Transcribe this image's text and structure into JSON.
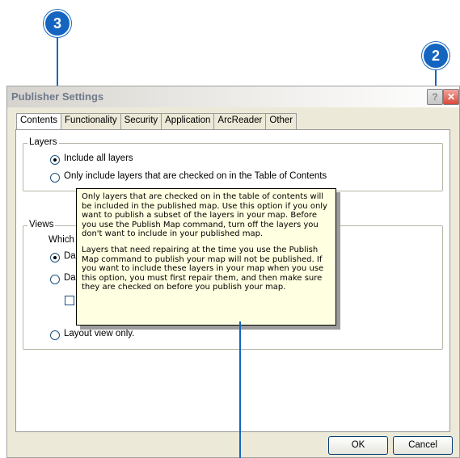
{
  "callouts": {
    "c3": "3",
    "c2": "2"
  },
  "dialog": {
    "title": "Publisher Settings",
    "help_icon": "question-icon",
    "close_icon": "close-icon",
    "tabs": [
      "Contents",
      "Functionality",
      "Security",
      "Application",
      "ArcReader",
      "Other"
    ],
    "layers": {
      "label": "Layers",
      "option_all": "Include all layers",
      "option_checked": "Only include layers that are checked on in the Table of Contents"
    },
    "views": {
      "label": "Views",
      "prompt_partial": "Which",
      "option1_partial": "Da",
      "option2_partial": "Da",
      "option3": "Layout view only."
    },
    "tooltip": {
      "p1": "Only layers that are checked on in the table of contents will be included in the published map. Use this option if you only want to publish a subset of the layers in your map. Before you use the Publish Map command, turn off the layers you don't want to include in your published map.",
      "p2": "Layers that need repairing at the time you use the Publish Map command to publish your map will not be published. If you want to include these layers in your map when you use this option, you must first repair them, and then make sure they are checked on before you publish your map."
    },
    "buttons": {
      "ok": "OK",
      "cancel": "Cancel"
    }
  },
  "colors": {
    "callout": "#1565c0",
    "tooltip_bg": "#ffffe1",
    "dialog_bg": "#ece9d8"
  }
}
